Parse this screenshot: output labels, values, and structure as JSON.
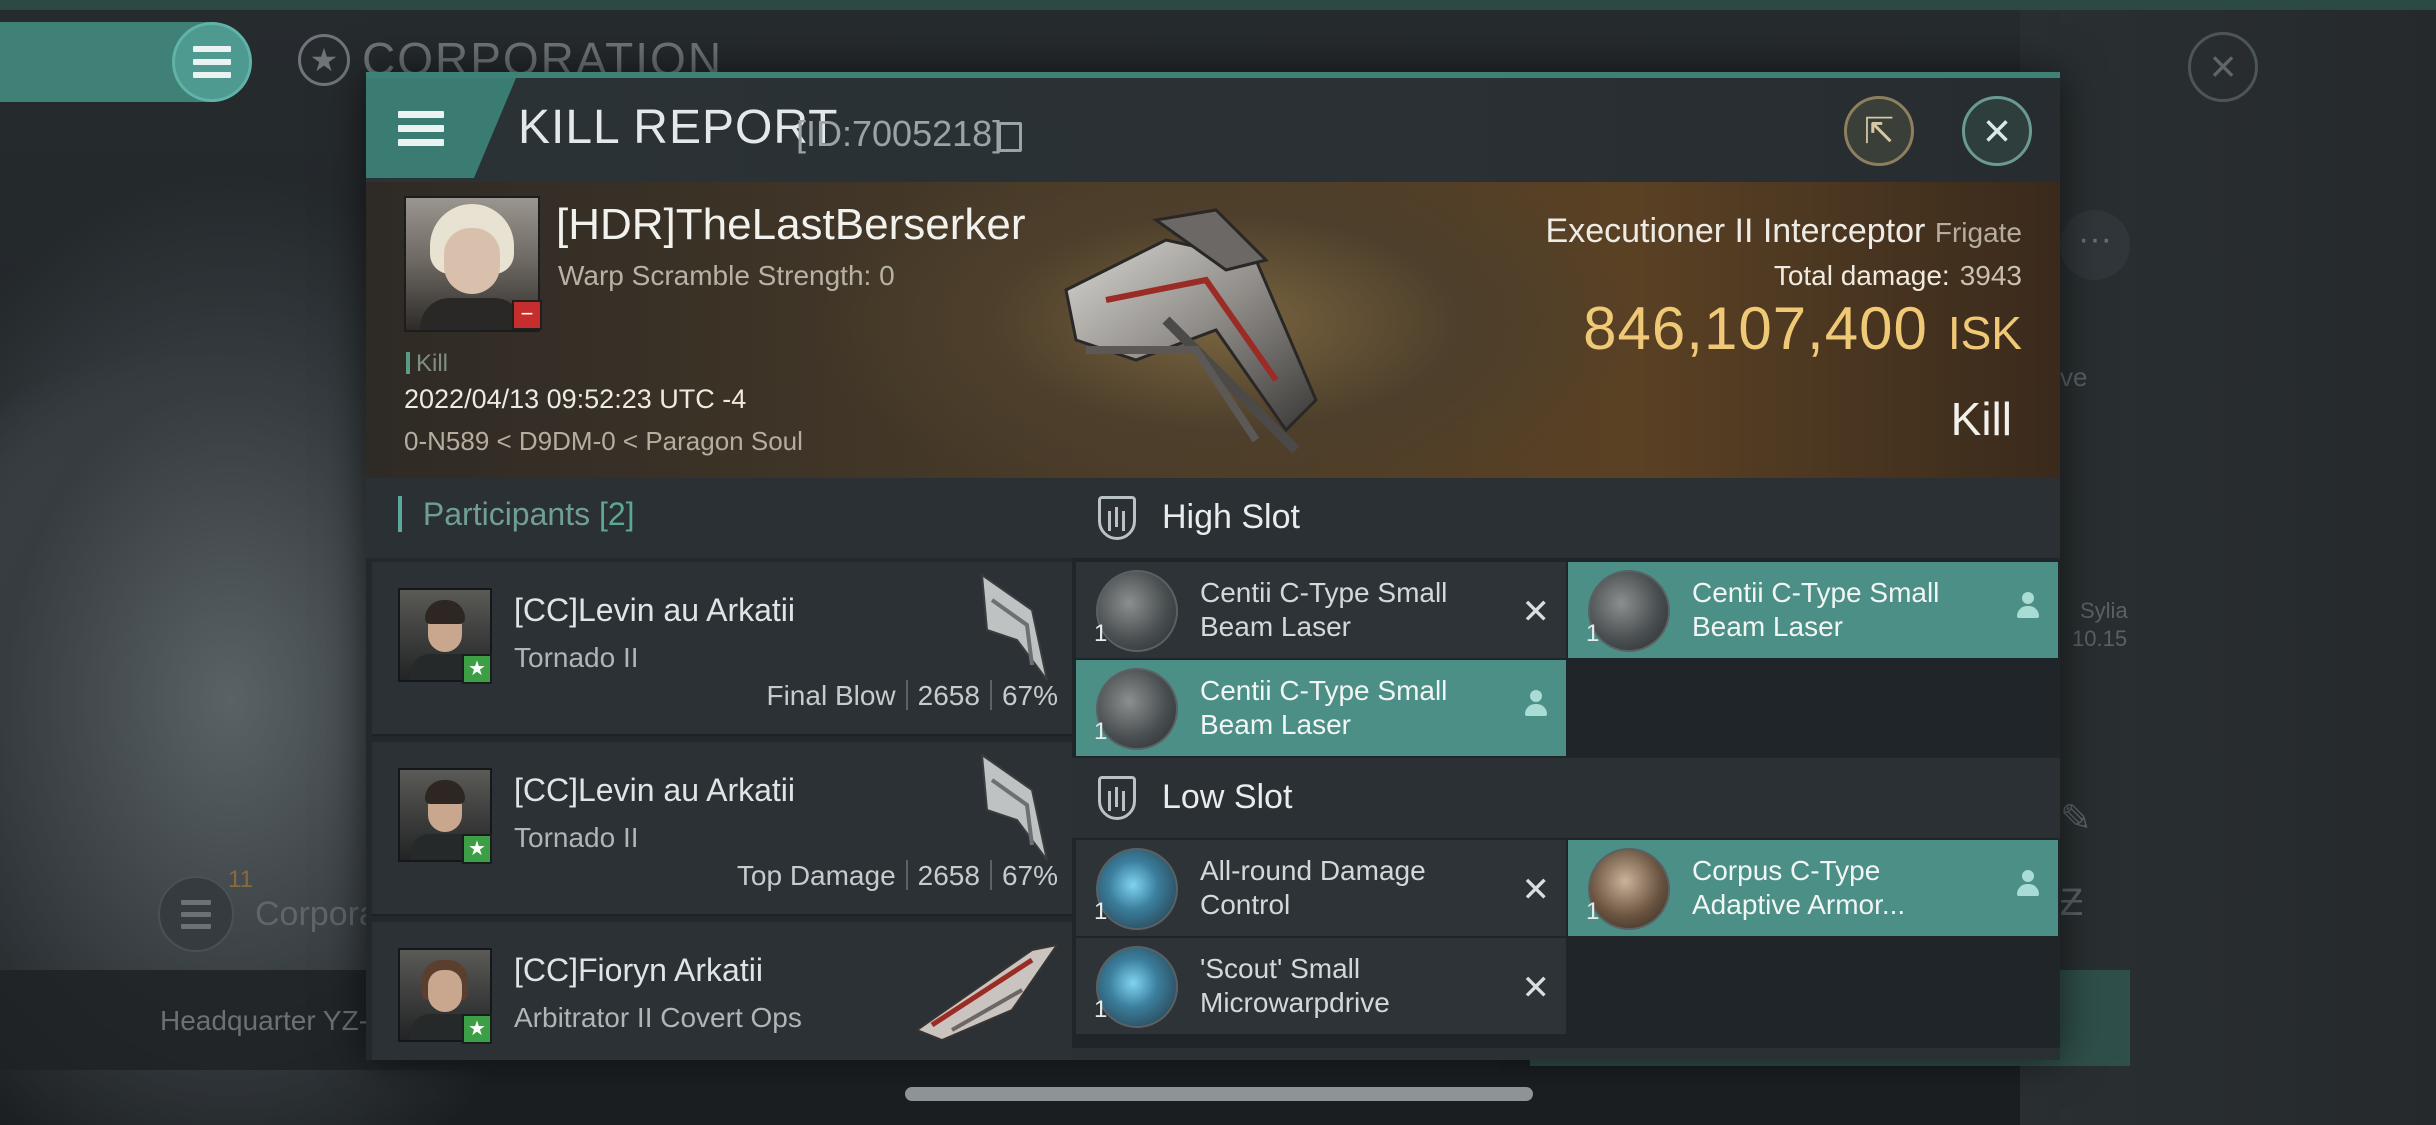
{
  "background": {
    "corporation_title": "CORPORATION",
    "corporation_mini_label": "Corpora",
    "corporation_mini_count": "11",
    "headquarter_label": "Headquarter YZ-",
    "side_text_1": "ve",
    "side_text_2": "Sylia",
    "side_text_3": "10.15"
  },
  "header": {
    "title": "KILL REPORT",
    "id_text": "[ID:7005218]"
  },
  "victim": {
    "name": "[HDR]TheLastBerserker",
    "warp_scramble": "Warp Scramble Strength: 0",
    "result_tag": "Kill",
    "date": "2022/04/13 09:52:23 UTC -4",
    "location": "0-N589 < D9DM-0 < Paragon Soul",
    "ship_name": "Executioner II Interceptor",
    "ship_class": "Frigate",
    "total_damage_label": "Total damage:",
    "total_damage_value": "3943",
    "isk_value": "846,107,400",
    "isk_unit": "ISK",
    "outcome": "Kill"
  },
  "participants": {
    "title": "Participants",
    "count": "[2]",
    "items": [
      {
        "name": "[CC]Levin au Arkatii",
        "ship": "Tornado II",
        "tag": "Final Blow",
        "damage": "2658",
        "percent": "67%"
      },
      {
        "name": "[CC]Levin au Arkatii",
        "ship": "Tornado II",
        "tag": "Top Damage",
        "damage": "2658",
        "percent": "67%"
      },
      {
        "name": "[CC]Fioryn Arkatii",
        "ship": "Arbitrator II Covert Ops"
      }
    ]
  },
  "modules": {
    "high_slot": {
      "title": "High Slot",
      "items": [
        {
          "name": "Centii C-Type Small Beam Laser",
          "qty": "1"
        },
        {
          "name": "Centii C-Type Small Beam Laser",
          "qty": "1"
        },
        {
          "name": "Centii C-Type Small Beam Laser",
          "qty": "1"
        }
      ]
    },
    "low_slot": {
      "title": "Low Slot",
      "items": [
        {
          "name": "All-round Damage Control",
          "qty": "1"
        },
        {
          "name": "Corpus C-Type Adaptive Armor...",
          "qty": "1"
        },
        {
          "name": "'Scout' Small Microwarpdrive",
          "qty": "1"
        }
      ]
    }
  },
  "colors": {
    "accent": "#3d8177",
    "isk": "#f0c977",
    "active_module": "#4c8f86"
  }
}
